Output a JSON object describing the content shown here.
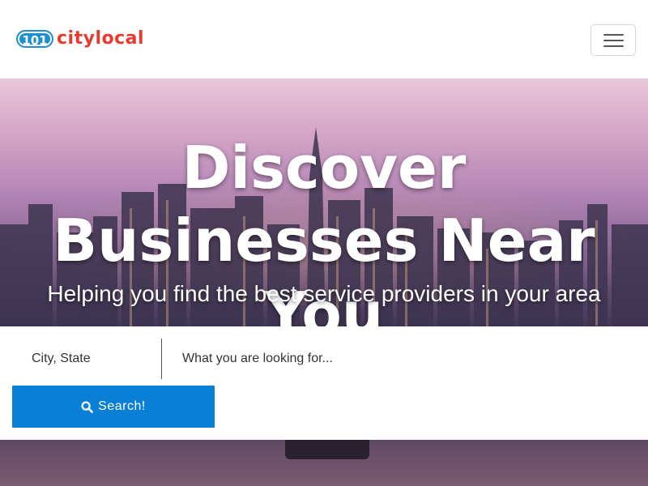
{
  "brand": {
    "badge": "101",
    "name": "citylocal",
    "colors": {
      "badge": "#1e8fd6",
      "text": "#e63b2e"
    }
  },
  "nav": {
    "menu_icon": "hamburger-icon"
  },
  "hero": {
    "headline": "Discover Businesses Near You",
    "subhead": "Helping you find the best service providers in your area"
  },
  "search": {
    "location_placeholder": "City, State",
    "query_placeholder": "What you are looking for...",
    "button_label": "Search!",
    "button_icon": "search-icon",
    "button_color": "#0a7fd6"
  }
}
